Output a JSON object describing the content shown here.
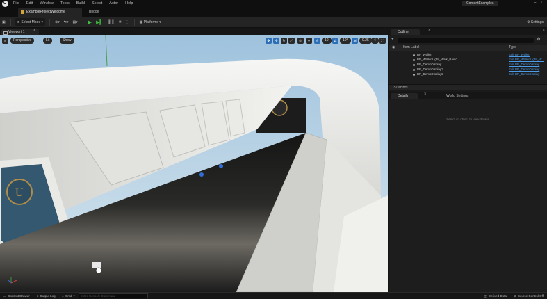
{
  "menu": {
    "items": [
      "File",
      "Edit",
      "Window",
      "Tools",
      "Build",
      "Select",
      "Actor",
      "Help"
    ],
    "project_label": "ContentExamples"
  },
  "tabs": {
    "project": "ExampleProjectWelcome",
    "bridge": "Bridge"
  },
  "toolbar": {
    "mode": "Select Mode",
    "platforms": "Platforms",
    "settings": "Settings"
  },
  "viewport": {
    "tab": "Viewport 1",
    "perspective": "Perspective",
    "lit": "Lit",
    "show": "Show",
    "grid_size": "10",
    "angle": "10°",
    "scale": "0.25",
    "camera_speed": "4"
  },
  "outliner": {
    "tab": "Outliner",
    "col_label": "Item Label",
    "col_type": "Type",
    "rows": [
      {
        "name": "BP_Walkin",
        "type": "Edit BP_Walkin"
      },
      {
        "name": "BP_WalkinLight_Walk_Basic",
        "type": "Edit BP_WalkinLight_W..."
      },
      {
        "name": "BP_DemoDisplay",
        "type": "Edit BP_DemoDisplay"
      },
      {
        "name": "BP_DemoDisplay3",
        "type": "Edit BP_DemoDisplay"
      },
      {
        "name": "BP_DemoDisplay2",
        "type": "Edit BP_DemoDisplay"
      }
    ],
    "actors_count": "32 actors"
  },
  "details": {
    "tab": "Details",
    "world_settings": "World Settings",
    "hint": "Select an object to view details."
  },
  "bottom": {
    "content_drawer": "Content Drawer",
    "output_log": "Output Log",
    "cmd": "Cmd",
    "cmd_placeholder": "Enter Console Command",
    "derived_data": "Derived Data",
    "source_control": "Source Control Off"
  }
}
